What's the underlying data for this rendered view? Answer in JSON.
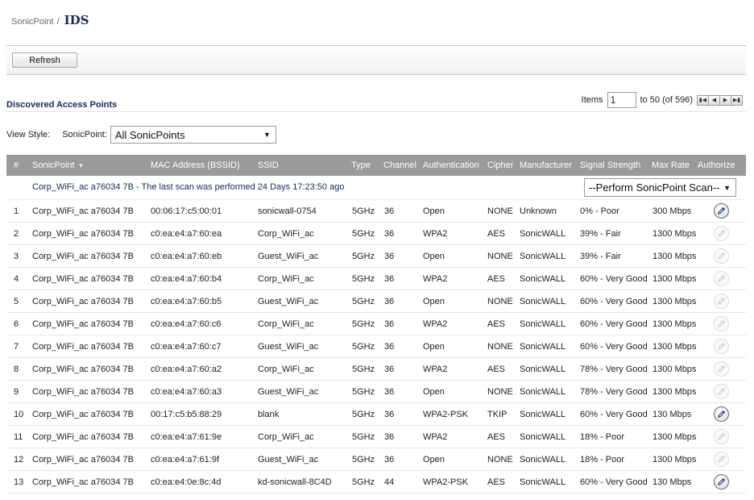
{
  "breadcrumb": {
    "parent": "SonicPoint",
    "separator": "/",
    "title": "IDS"
  },
  "toolbar": {
    "refresh_label": "Refresh"
  },
  "section": {
    "title": "Discovered Access Points"
  },
  "pager": {
    "items_label": "Items",
    "current_start": "1",
    "range_text": "to 50 (of 596)",
    "buttons": [
      "first-page",
      "prev-page",
      "next-page",
      "last-page"
    ]
  },
  "view_style": {
    "label": "View Style:",
    "sonicpoint_label": "SonicPoint:",
    "sonicpoint_value": "All SonicPoints"
  },
  "table": {
    "columns": [
      "#",
      "SonicPoint",
      "MAC Address (BSSID)",
      "SSID",
      "Type",
      "Channel",
      "Authentication",
      "Cipher",
      "Manufacturer",
      "Signal Strength",
      "Max Rate",
      "Authorize"
    ],
    "sort_column": "SonicPoint",
    "group": {
      "text": "Corp_WiFi_ac a76034 7B - The last scan was performed 24 Days 17:23:50 ago",
      "scan_select_value": "--Perform SonicPoint Scan--"
    },
    "rows": [
      {
        "num": "1",
        "sonicpoint": "Corp_WiFi_ac a76034 7B",
        "mac": "00:06:17:c5:00:01",
        "ssid": "sonicwall-0754",
        "type": "5GHz",
        "channel": "36",
        "auth": "Open",
        "cipher": "NONE",
        "manufacturer": "Unknown",
        "signal": "0% - Poor",
        "rate": "300 Mbps",
        "authorize": "active"
      },
      {
        "num": "2",
        "sonicpoint": "Corp_WiFi_ac a76034 7B",
        "mac": "c0:ea:e4:a7:60:ea",
        "ssid": "Corp_WiFi_ac",
        "type": "5GHz",
        "channel": "36",
        "auth": "WPA2",
        "cipher": "AES",
        "manufacturer": "SonicWALL",
        "signal": "39% - Fair",
        "rate": "1300 Mbps",
        "authorize": "disabled"
      },
      {
        "num": "3",
        "sonicpoint": "Corp_WiFi_ac a76034 7B",
        "mac": "c0:ea:e4:a7:60:eb",
        "ssid": "Guest_WiFi_ac",
        "type": "5GHz",
        "channel": "36",
        "auth": "Open",
        "cipher": "NONE",
        "manufacturer": "SonicWALL",
        "signal": "39% - Fair",
        "rate": "1300 Mbps",
        "authorize": "disabled"
      },
      {
        "num": "4",
        "sonicpoint": "Corp_WiFi_ac a76034 7B",
        "mac": "c0:ea:e4:a7:60:b4",
        "ssid": "Corp_WiFi_ac",
        "type": "5GHz",
        "channel": "36",
        "auth": "WPA2",
        "cipher": "AES",
        "manufacturer": "SonicWALL",
        "signal": "60% - Very Good",
        "rate": "1300 Mbps",
        "authorize": "disabled"
      },
      {
        "num": "5",
        "sonicpoint": "Corp_WiFi_ac a76034 7B",
        "mac": "c0:ea:e4:a7:60:b5",
        "ssid": "Guest_WiFi_ac",
        "type": "5GHz",
        "channel": "36",
        "auth": "Open",
        "cipher": "NONE",
        "manufacturer": "SonicWALL",
        "signal": "60% - Very Good",
        "rate": "1300 Mbps",
        "authorize": "disabled"
      },
      {
        "num": "6",
        "sonicpoint": "Corp_WiFi_ac a76034 7B",
        "mac": "c0:ea:e4:a7:60:c6",
        "ssid": "Corp_WiFi_ac",
        "type": "5GHz",
        "channel": "36",
        "auth": "WPA2",
        "cipher": "AES",
        "manufacturer": "SonicWALL",
        "signal": "60% - Very Good",
        "rate": "1300 Mbps",
        "authorize": "disabled"
      },
      {
        "num": "7",
        "sonicpoint": "Corp_WiFi_ac a76034 7B",
        "mac": "c0:ea:e4:a7:60:c7",
        "ssid": "Guest_WiFi_ac",
        "type": "5GHz",
        "channel": "36",
        "auth": "Open",
        "cipher": "NONE",
        "manufacturer": "SonicWALL",
        "signal": "60% - Very Good",
        "rate": "1300 Mbps",
        "authorize": "disabled"
      },
      {
        "num": "8",
        "sonicpoint": "Corp_WiFi_ac a76034 7B",
        "mac": "c0:ea:e4:a7:60:a2",
        "ssid": "Corp_WiFi_ac",
        "type": "5GHz",
        "channel": "36",
        "auth": "WPA2",
        "cipher": "AES",
        "manufacturer": "SonicWALL",
        "signal": "78% - Very Good",
        "rate": "1300 Mbps",
        "authorize": "disabled"
      },
      {
        "num": "9",
        "sonicpoint": "Corp_WiFi_ac a76034 7B",
        "mac": "c0:ea:e4:a7:60:a3",
        "ssid": "Guest_WiFi_ac",
        "type": "5GHz",
        "channel": "36",
        "auth": "Open",
        "cipher": "NONE",
        "manufacturer": "SonicWALL",
        "signal": "78% - Very Good",
        "rate": "1300 Mbps",
        "authorize": "disabled"
      },
      {
        "num": "10",
        "sonicpoint": "Corp_WiFi_ac a76034 7B",
        "mac": "00:17:c5:b5:88:29",
        "ssid": "blank",
        "type": "5GHz",
        "channel": "36",
        "auth": "WPA2-PSK",
        "cipher": "TKIP",
        "manufacturer": "SonicWALL",
        "signal": "60% - Very Good",
        "rate": "130 Mbps",
        "authorize": "active"
      },
      {
        "num": "11",
        "sonicpoint": "Corp_WiFi_ac a76034 7B",
        "mac": "c0:ea:e4:a7:61:9e",
        "ssid": "Corp_WiFi_ac",
        "type": "5GHz",
        "channel": "36",
        "auth": "WPA2",
        "cipher": "AES",
        "manufacturer": "SonicWALL",
        "signal": "18% - Poor",
        "rate": "1300 Mbps",
        "authorize": "disabled"
      },
      {
        "num": "12",
        "sonicpoint": "Corp_WiFi_ac a76034 7B",
        "mac": "c0:ea:e4:a7:61:9f",
        "ssid": "Guest_WiFi_ac",
        "type": "5GHz",
        "channel": "36",
        "auth": "Open",
        "cipher": "NONE",
        "manufacturer": "SonicWALL",
        "signal": "18% - Poor",
        "rate": "1300 Mbps",
        "authorize": "disabled"
      },
      {
        "num": "13",
        "sonicpoint": "Corp_WiFi_ac a76034 7B",
        "mac": "c0:ea:e4:0e:8c:4d",
        "ssid": "kd-sonicwall-8C4D",
        "type": "5GHz",
        "channel": "44",
        "auth": "WPA2-PSK",
        "cipher": "AES",
        "manufacturer": "SonicWALL",
        "signal": "60% - Very Good",
        "rate": "130 Mbps",
        "authorize": "active"
      }
    ]
  },
  "colors": {
    "header_bg": "#9a9a9a",
    "title": "#1a2a5a",
    "sort_arrow": "#e6ecf5"
  }
}
